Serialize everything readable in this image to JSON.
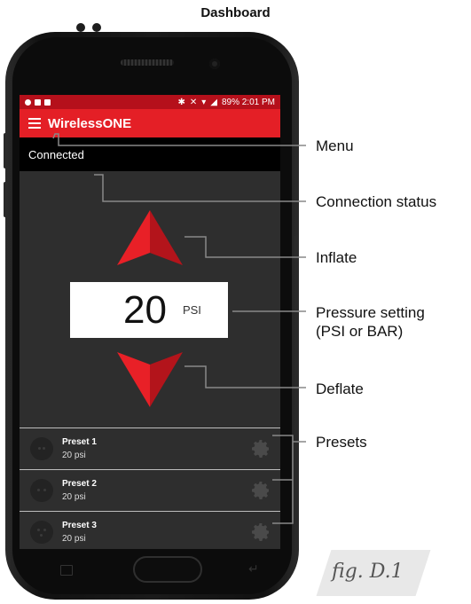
{
  "page": {
    "title": "Dashboard"
  },
  "statusbar": {
    "right_text": "89% 2:01 PM"
  },
  "app": {
    "title": "WirelessONE"
  },
  "connection": {
    "status": "Connected"
  },
  "pressure": {
    "value": "20",
    "unit": "PSI"
  },
  "presets": [
    {
      "name": "Preset 1",
      "value": "20 psi"
    },
    {
      "name": "Preset 2",
      "value": "20 psi"
    },
    {
      "name": "Preset 3",
      "value": "20 psi"
    }
  ],
  "callouts": {
    "menu": "Menu",
    "connection_status": "Connection status",
    "inflate": "Inflate",
    "pressure_line1": "Pressure setting",
    "pressure_line2": "(PSI or BAR)",
    "deflate": "Deflate",
    "presets": "Presets"
  },
  "figure_label": "fig. D.1",
  "colors": {
    "accent": "#e41f26",
    "statusbar": "#b5101b",
    "screen_bg": "#2e2e2e"
  }
}
